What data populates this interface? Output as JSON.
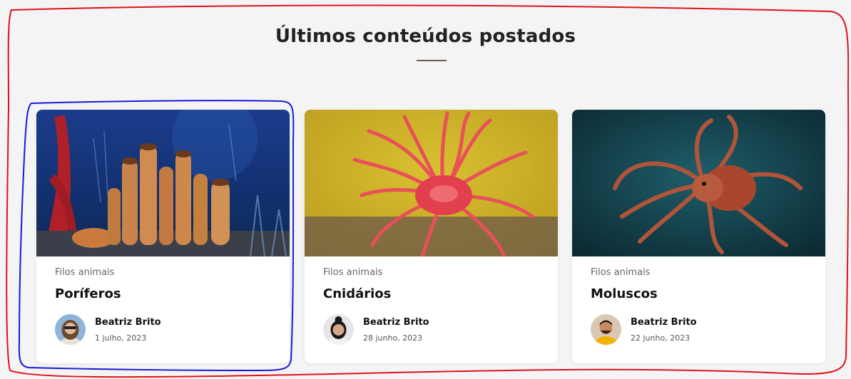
{
  "section": {
    "title": "Últimos conteúdos postados"
  },
  "cards": [
    {
      "category": "Filos animais",
      "title": "Poríferos",
      "author": "Beatriz Brito",
      "date": "1 julho, 2023"
    },
    {
      "category": "Filos animais",
      "title": "Cnidários",
      "author": "Beatriz Brito",
      "date": "28 junho, 2023"
    },
    {
      "category": "Filos animais",
      "title": "Moluscos",
      "author": "Beatriz Brito",
      "date": "22 junho, 2023"
    }
  ],
  "colors": {
    "background": "#f4f4f4",
    "divider": "#7a5a4a",
    "annotation_red": "#e0121b",
    "annotation_blue": "#1a1ad6"
  },
  "images": [
    "sponge-photo",
    "sea-anemone-photo",
    "octopus-photo"
  ]
}
